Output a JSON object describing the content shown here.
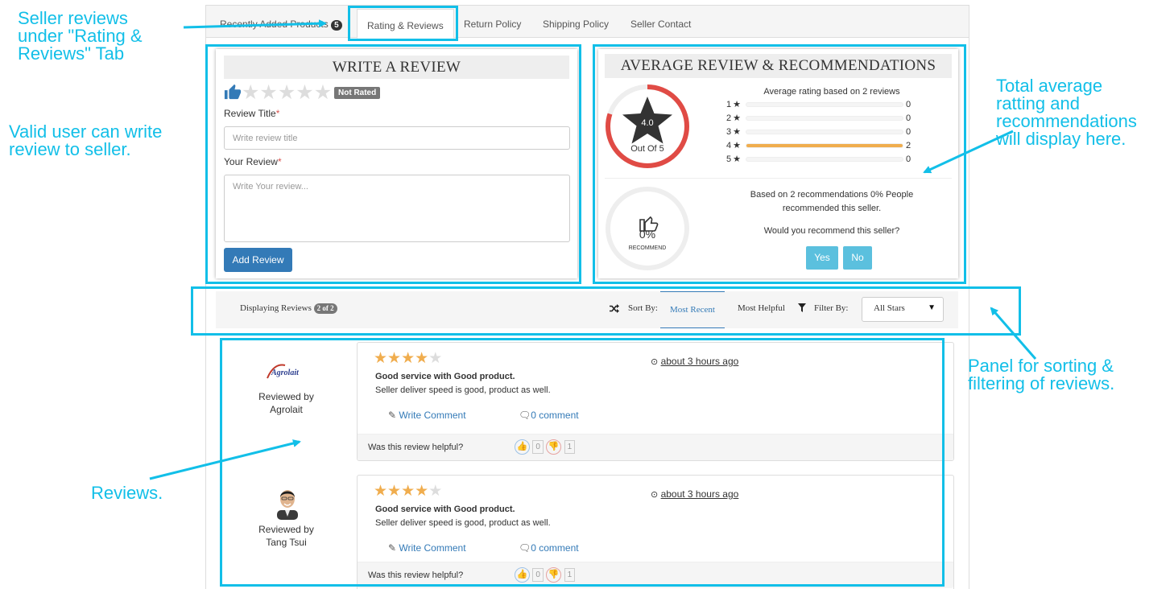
{
  "callouts": {
    "tab_note": [
      "Seller reviews",
      "under \"Rating &",
      "Reviews\" Tab"
    ],
    "write_note": [
      "Valid user can write",
      "review to seller."
    ],
    "average_note": [
      "Total average",
      "ratting and",
      "recommendations",
      "will display here."
    ],
    "panel_note": [
      "Panel for sorting &",
      "filtering of reviews."
    ],
    "reviews_note": "Reviews.",
    "color": "#12bfe8"
  },
  "tabs": {
    "recent": "Recently Added Products",
    "recent_badge": "5",
    "rating": "Rating & Reviews",
    "return": "Return Policy",
    "shipping": "Shipping Policy",
    "contact": "Seller Contact"
  },
  "write_review": {
    "title": "WRITE A REVIEW",
    "not_rated": "Not Rated",
    "title_label": "Review Title",
    "title_placeholder": "Write review title",
    "review_label": "Your Review",
    "review_placeholder": "Write Your review...",
    "button": "Add Review"
  },
  "average": {
    "title": "AVERAGE REVIEW & RECOMMENDATIONS",
    "score": "4.0",
    "out_of": "Out Of 5",
    "based_on": "Average rating based on 2 reviews",
    "rows": [
      {
        "star": "1",
        "count": "0",
        "fraction": 0
      },
      {
        "star": "2",
        "count": "0",
        "fraction": 0
      },
      {
        "star": "3",
        "count": "0",
        "fraction": 0
      },
      {
        "star": "4",
        "count": "2",
        "fraction": 1
      },
      {
        "star": "5",
        "count": "0",
        "fraction": 0
      }
    ],
    "rating_ring_fraction": 0.8,
    "recommend_percent": "0%",
    "recommend_label": "RECOMMEND",
    "recommend_text_1": "Based on 2 recommendations 0% People",
    "recommend_text_2": "recommended this seller.",
    "question": "Would you recommend this seller?",
    "yes": "Yes",
    "no": "No"
  },
  "sort_panel": {
    "displaying": "Displaying Reviews",
    "displaying_badge": "2 of 2",
    "sort_by": "Sort By:",
    "most_recent": "Most Recent",
    "most_helpful": "Most Helpful",
    "filter_by": "Filter By:",
    "filter_value": "All Stars"
  },
  "reviews": [
    {
      "reviewed_by": "Reviewed by",
      "reviewer": "Agrolait",
      "logo_text": "Agrolait",
      "stars": 4,
      "time": "about 3 hours ago",
      "title": "Good service with Good product.",
      "body": "Seller deliver speed is good, product as well.",
      "write_comment": "Write Comment",
      "comments": "0 comment",
      "helpful": "Was this review helpful?",
      "up": "0",
      "down": "1"
    },
    {
      "reviewed_by": "Reviewed by",
      "reviewer": "Tang Tsui",
      "stars": 4,
      "time": "about 3 hours ago",
      "title": "Good service with Good product.",
      "body": "Seller deliver speed is good, product as well.",
      "write_comment": "Write Comment",
      "comments": "0 comment",
      "helpful": "Was this review helpful?",
      "up": "0",
      "down": "1"
    }
  ]
}
